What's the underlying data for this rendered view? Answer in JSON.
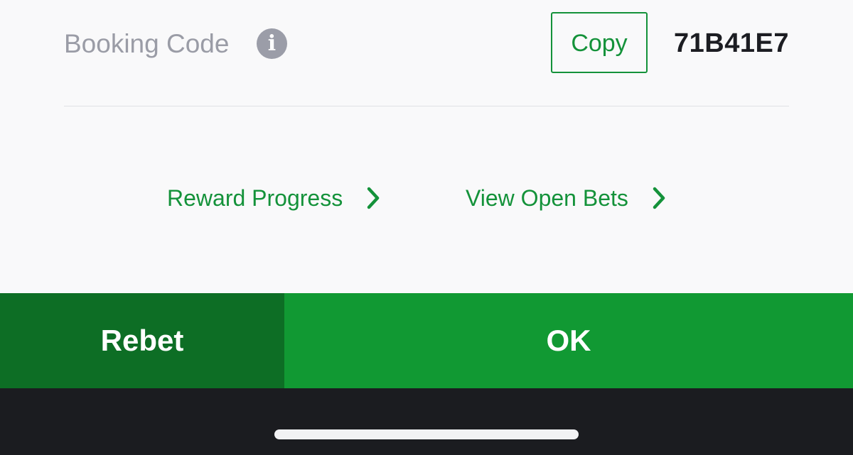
{
  "booking": {
    "label": "Booking Code",
    "info_icon": "info-icon",
    "info_glyph": "i",
    "copy_label": "Copy",
    "code": "71B41E7"
  },
  "links": {
    "reward_progress": "Reward Progress",
    "view_open_bets": "View Open Bets",
    "chevron_icon": "chevron-right-icon"
  },
  "actions": {
    "rebet_label": "Rebet",
    "ok_label": "OK"
  },
  "colors": {
    "accent_green": "#14923a",
    "rebet_green": "#0d6e25",
    "ok_green": "#119933",
    "label_gray": "#9a9ca6",
    "bottom_bar": "#1b1c20"
  }
}
